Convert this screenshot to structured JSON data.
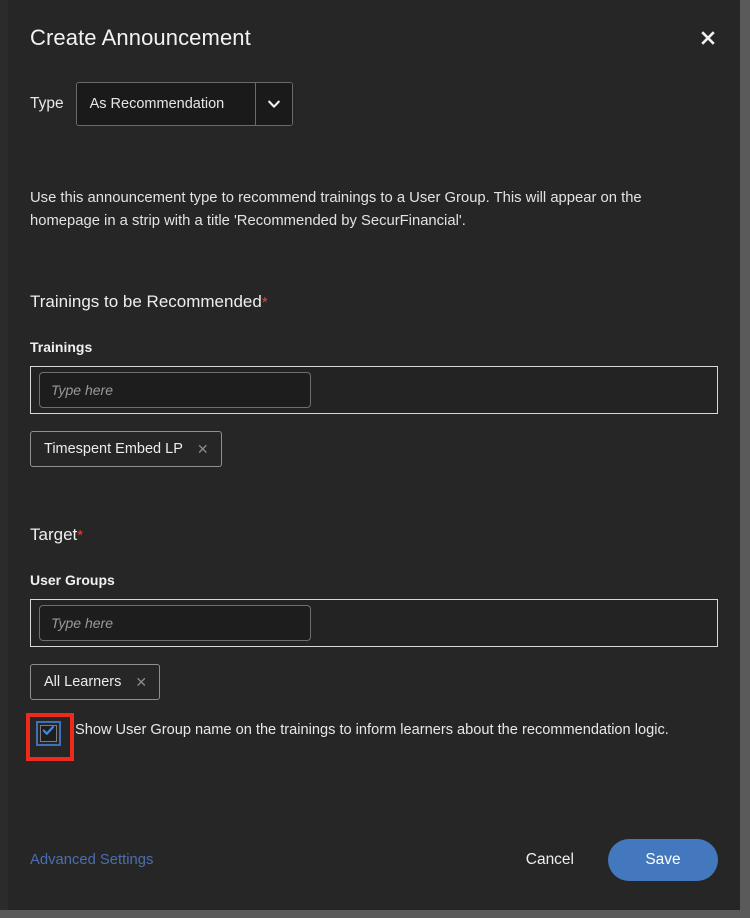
{
  "dialog": {
    "title": "Create Announcement",
    "close_icon": "close-icon"
  },
  "type_field": {
    "label": "Type",
    "selected_value": "As Recommendation",
    "caret_icon": "chevron-down-icon"
  },
  "description": "Use this announcement type to recommend trainings to a User Group. This will appear on the homepage in a strip with a title 'Recommended by SecurFinancial'.",
  "trainings_section": {
    "heading": "Trainings to be Recommended",
    "required_marker": "*",
    "field_label": "Trainings",
    "input_placeholder": "Type here",
    "input_value": "",
    "chips": [
      {
        "label": "Timespent Embed LP",
        "remove_icon": "close-icon"
      }
    ]
  },
  "target_section": {
    "heading": "Target",
    "required_marker": "*",
    "field_label": "User Groups",
    "input_placeholder": "Type here",
    "input_value": "",
    "chips": [
      {
        "label": "All Learners",
        "remove_icon": "close-icon"
      }
    ],
    "checkbox": {
      "label": "Show User Group name on the trainings to inform learners about the recommendation logic.",
      "checked": true,
      "highlight_color": "#ee2a1e",
      "focus_color": "#3f6fb5",
      "check_color": "#4a86d8"
    }
  },
  "footer": {
    "advanced_settings_label": "Advanced Settings",
    "advanced_settings_color": "#4a6fae",
    "cancel_label": "Cancel",
    "save_label": "Save",
    "save_color": "#4378be"
  },
  "theme": {
    "dialog_bg": "#262626",
    "page_bg": "#5a5a5a",
    "text_primary": "#eeeeee",
    "required_color": "#e8462e"
  }
}
